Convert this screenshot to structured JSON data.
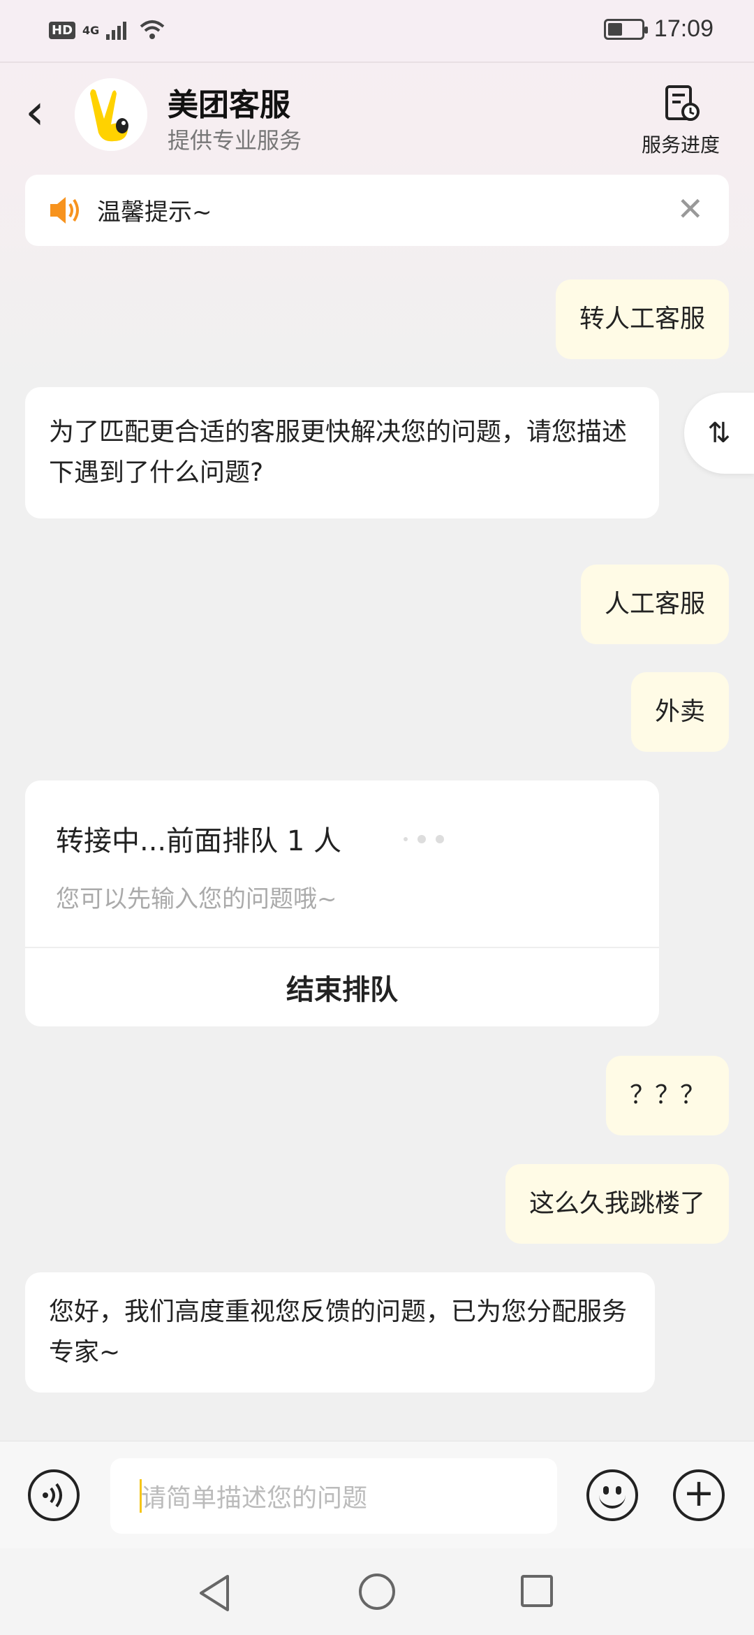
{
  "status_bar": {
    "hd": "HD",
    "network": "4G",
    "time": "17:09"
  },
  "header": {
    "title": "美团客服",
    "subtitle": "提供专业服务",
    "progress_label": "服务进度"
  },
  "notice": {
    "text": "温馨提示~"
  },
  "messages": [
    {
      "from": "me",
      "text": "转人工客服"
    },
    {
      "from": "bot",
      "text": "为了匹配更合适的客服更快解决您的问题，请您描述下遇到了什么问题?"
    },
    {
      "from": "me",
      "text": "人工客服"
    },
    {
      "from": "me",
      "text": "外卖"
    },
    {
      "from": "me",
      "text": "？？？"
    },
    {
      "from": "me",
      "text": "这么久我跳楼了"
    },
    {
      "from": "bot",
      "text": "您好，我们高度重视您反馈的问题，已为您分配服务专家~"
    }
  ],
  "queue_card": {
    "title": "转接中...前面排队 1 人",
    "subtitle": "您可以先输入您的问题哦~",
    "end_label": "结束排队"
  },
  "swap_icon": "⇅",
  "input": {
    "placeholder": "请简单描述您的问题"
  },
  "colors": {
    "my_bubble": "#fffbe6",
    "accent": "#f5c518",
    "speaker": "#f7931e"
  }
}
